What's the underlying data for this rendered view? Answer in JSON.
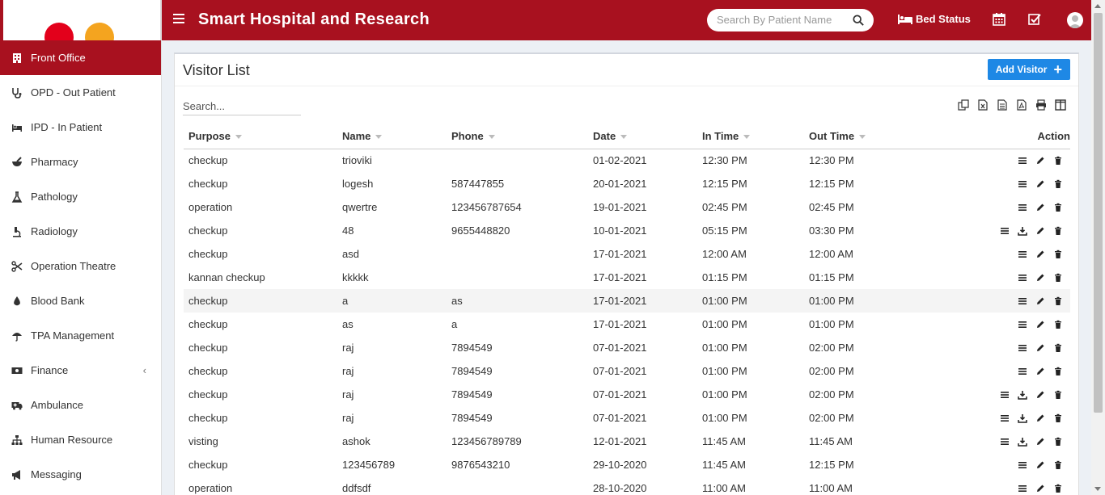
{
  "header": {
    "title": "Smart Hospital and Research",
    "search_placeholder": "Search By Patient Name",
    "bed_status_label": "Bed Status"
  },
  "sidebar": {
    "items": [
      {
        "label": "Front Office",
        "icon": "building-icon",
        "active": true
      },
      {
        "label": "OPD - Out Patient",
        "icon": "stethoscope-icon"
      },
      {
        "label": "IPD - In Patient",
        "icon": "bed-icon"
      },
      {
        "label": "Pharmacy",
        "icon": "mortar-pestle-icon"
      },
      {
        "label": "Pathology",
        "icon": "flask-icon"
      },
      {
        "label": "Radiology",
        "icon": "microscope-icon"
      },
      {
        "label": "Operation Theatre",
        "icon": "scissors-icon"
      },
      {
        "label": "Blood Bank",
        "icon": "tint-icon"
      },
      {
        "label": "TPA Management",
        "icon": "umbrella-icon"
      },
      {
        "label": "Finance",
        "icon": "money-icon",
        "has_submenu": true
      },
      {
        "label": "Ambulance",
        "icon": "ambulance-icon"
      },
      {
        "label": "Human Resource",
        "icon": "sitemap-icon"
      },
      {
        "label": "Messaging",
        "icon": "bullhorn-icon"
      }
    ]
  },
  "page": {
    "title": "Visitor List",
    "add_button_label": "Add Visitor",
    "search_placeholder": "Search..."
  },
  "table": {
    "columns": [
      "Purpose",
      "Name",
      "Phone",
      "Date",
      "In Time",
      "Out Time",
      "Action"
    ],
    "rows": [
      {
        "purpose": "checkup",
        "name": "trioviki",
        "phone": "",
        "date": "01-02-2021",
        "in": "12:30 PM",
        "out": "12:30 PM",
        "download": false
      },
      {
        "purpose": "checkup",
        "name": "logesh",
        "phone": "587447855",
        "date": "20-01-2021",
        "in": "12:15 PM",
        "out": "12:15 PM",
        "download": false
      },
      {
        "purpose": "operation",
        "name": "qwertre",
        "phone": "123456787654",
        "date": "19-01-2021",
        "in": "02:45 PM",
        "out": "02:45 PM",
        "download": false
      },
      {
        "purpose": "checkup",
        "name": "48",
        "phone": "9655448820",
        "date": "10-01-2021",
        "in": "05:15 PM",
        "out": "03:30 PM",
        "download": true
      },
      {
        "purpose": "checkup",
        "name": "asd",
        "phone": "",
        "date": "17-01-2021",
        "in": "12:00 AM",
        "out": "12:00 AM",
        "download": false
      },
      {
        "purpose": "kannan checkup",
        "name": "kkkkk",
        "phone": "",
        "date": "17-01-2021",
        "in": "01:15 PM",
        "out": "01:15 PM",
        "download": false
      },
      {
        "purpose": "checkup",
        "name": "a",
        "phone": "as",
        "date": "17-01-2021",
        "in": "01:00 PM",
        "out": "01:00 PM",
        "download": false,
        "highlight": true
      },
      {
        "purpose": "checkup",
        "name": "as",
        "phone": "a",
        "date": "17-01-2021",
        "in": "01:00 PM",
        "out": "01:00 PM",
        "download": false
      },
      {
        "purpose": "checkup",
        "name": "raj",
        "phone": "7894549",
        "date": "07-01-2021",
        "in": "01:00 PM",
        "out": "02:00 PM",
        "download": false
      },
      {
        "purpose": "checkup",
        "name": "raj",
        "phone": "7894549",
        "date": "07-01-2021",
        "in": "01:00 PM",
        "out": "02:00 PM",
        "download": false
      },
      {
        "purpose": "checkup",
        "name": "raj",
        "phone": "7894549",
        "date": "07-01-2021",
        "in": "01:00 PM",
        "out": "02:00 PM",
        "download": true
      },
      {
        "purpose": "checkup",
        "name": "raj",
        "phone": "7894549",
        "date": "07-01-2021",
        "in": "01:00 PM",
        "out": "02:00 PM",
        "download": true
      },
      {
        "purpose": "visting",
        "name": "ashok",
        "phone": "123456789789",
        "date": "12-01-2021",
        "in": "11:45 AM",
        "out": "11:45 AM",
        "download": true
      },
      {
        "purpose": "checkup",
        "name": "123456789",
        "phone": "9876543210",
        "date": "29-10-2020",
        "in": "11:45 AM",
        "out": "12:15 PM",
        "download": false
      },
      {
        "purpose": "operation",
        "name": "ddfsdf",
        "phone": "",
        "date": "28-10-2020",
        "in": "11:00 AM",
        "out": "11:00 AM",
        "download": false
      }
    ]
  },
  "colors": {
    "brand": "#a8111f",
    "button": "#1e88e5"
  }
}
